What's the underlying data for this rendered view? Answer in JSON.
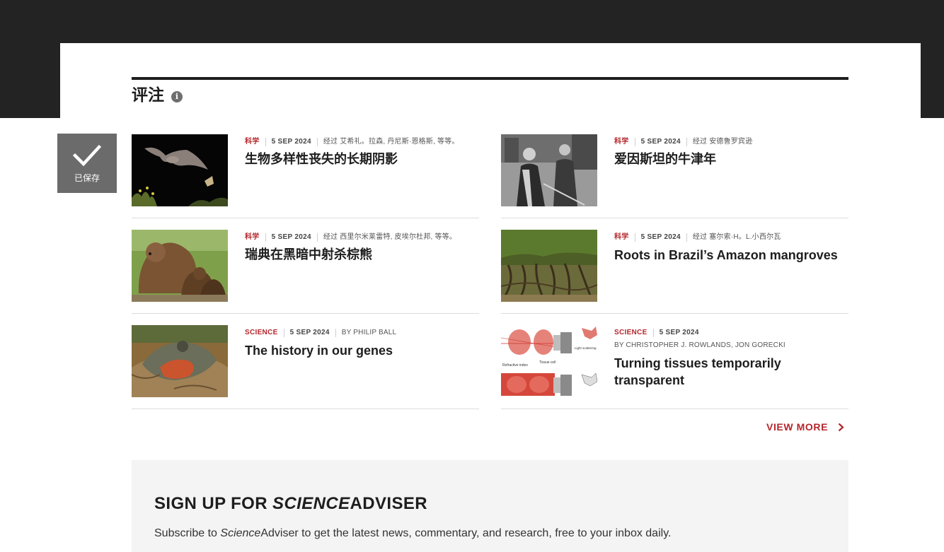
{
  "section": {
    "title": "评注",
    "info_icon": "info-icon"
  },
  "saved_badge": {
    "label": "已保存",
    "icon": "checkmark-icon"
  },
  "articles": [
    {
      "category": "科学",
      "date": "5 SEP 2024",
      "byline": "经过 艾希礼。拉森, 丹尼斯·恩格斯, 等等。",
      "title": "生物多样性丧失的长期阴影",
      "image": "bat-and-moth"
    },
    {
      "category": "科学",
      "date": "5 SEP 2024",
      "byline": "经过 安德鲁罗宾逊",
      "title": "爱因斯坦的牛津年",
      "image": "historic-photo-einstein"
    },
    {
      "category": "科学",
      "date": "5 SEP 2024",
      "byline": "经过 西里尔米莱雷特, 皮埃尔杜邦, 等等。",
      "title": "瑞典在黑暗中射杀棕熊",
      "image": "brown-bears"
    },
    {
      "category": "科学",
      "date": "5 SEP 2024",
      "byline": "经过 塞尔索·H。L.小西尔瓦",
      "title": "Roots in Brazil’s Amazon mangroves",
      "image": "mangrove-roots"
    },
    {
      "category": "SCIENCE",
      "date": "5 SEP 2024",
      "byline": "BY PHILIP BALL",
      "title": "The history in our genes",
      "image": "bird-nest"
    },
    {
      "category": "SCIENCE",
      "date": "5 SEP 2024",
      "byline": "BY CHRISTOPHER J. ROWLANDS, JON GORECKI",
      "title": "Turning tissues temporarily transparent",
      "image": "tissue-diagram",
      "diagram_labels": [
        "Tissue cell",
        "Light scattering",
        "Refractive index"
      ]
    }
  ],
  "view_more": {
    "label": "VIEW MORE",
    "icon": "chevron-right-icon"
  },
  "signup": {
    "heading_prefix": "SIGN UP FOR ",
    "heading_brand": "SCIENCE",
    "heading_suffix": "ADVISER",
    "text_prefix": "Subscribe to ",
    "text_brand": "Science",
    "text_suffix": "Adviser to get the latest news, commentary, and research, free to your inbox daily."
  },
  "colors": {
    "accent": "#b4262b",
    "dark_band": "#232323",
    "badge": "#6b6b6b",
    "signup_bg": "#f4f4f4"
  }
}
